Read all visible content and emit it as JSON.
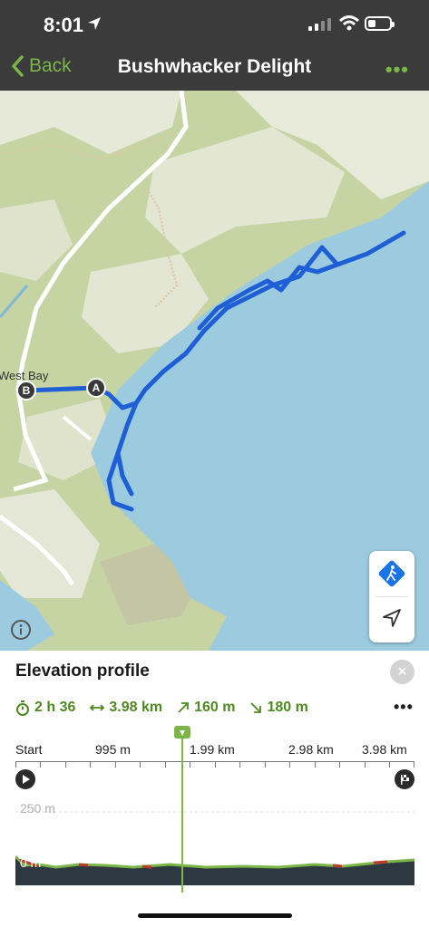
{
  "status_bar": {
    "time": "8:01"
  },
  "nav": {
    "back_label": "Back",
    "title": "Bushwhacker Delight",
    "more_label": "•••"
  },
  "map": {
    "place_label": "West Bay",
    "waypoint_a": "A",
    "waypoint_b": "B",
    "colors": {
      "water": "#9ccbe0",
      "land": "#c9d6a8",
      "route": "#1f5fd6"
    },
    "icons": [
      "hiking-mode-icon",
      "locate-me-icon",
      "info-icon"
    ]
  },
  "elevation_panel": {
    "title": "Elevation profile",
    "close_label": "×",
    "stats": {
      "duration": "2 h 36",
      "distance": "3.98 km",
      "ascent": "160 m",
      "descent": "180 m"
    },
    "more_label": "•••",
    "distance_axis": [
      "Start",
      "995 m",
      "1.99 km",
      "2.98 km",
      "3.98 km"
    ],
    "elevation_labels": [
      "250 m",
      "0 m"
    ],
    "colors": {
      "accent": "#7ab648",
      "profile_fill": "#2e3841"
    }
  }
}
